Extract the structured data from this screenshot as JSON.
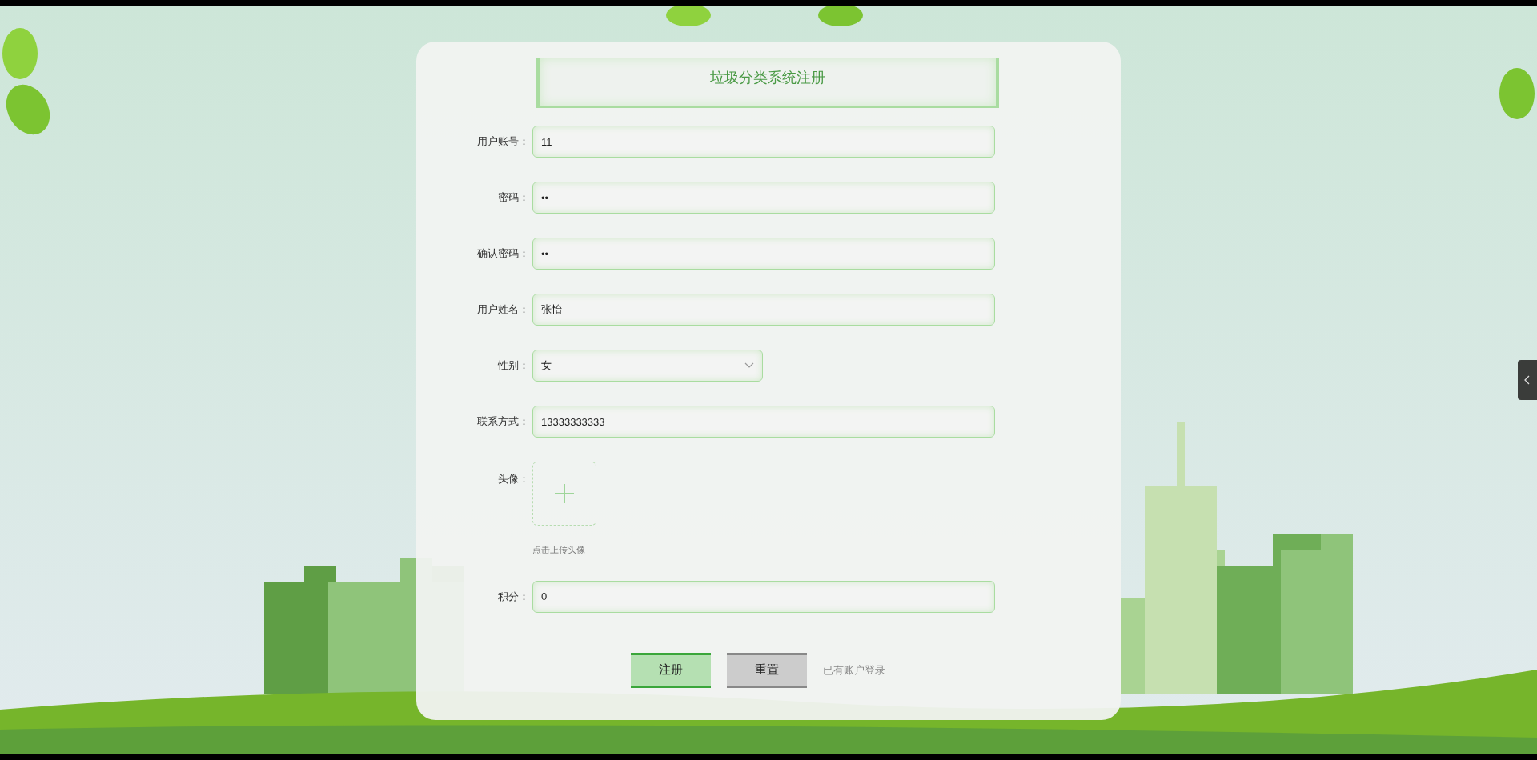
{
  "form": {
    "title": "垃圾分类系统注册",
    "fields": [
      {
        "kind": "text",
        "label": "用户账号：",
        "value": "11"
      },
      {
        "kind": "text",
        "label": "密码：",
        "value": "••"
      },
      {
        "kind": "text",
        "label": "确认密码：",
        "value": "••"
      },
      {
        "kind": "text",
        "label": "用户姓名：",
        "value": "张怡"
      },
      {
        "kind": "select",
        "label": "性别：",
        "value": "女"
      },
      {
        "kind": "text",
        "label": "联系方式：",
        "value": "13333333333"
      },
      {
        "kind": "upload",
        "label": "头像：",
        "hint": "点击上传头像"
      },
      {
        "kind": "text",
        "label": "积分：",
        "value": "0"
      }
    ],
    "buttons": [
      {
        "kind": "primary",
        "label": "注册"
      },
      {
        "kind": "secondary",
        "label": "重置"
      }
    ],
    "login_link": "已有账户登录"
  }
}
